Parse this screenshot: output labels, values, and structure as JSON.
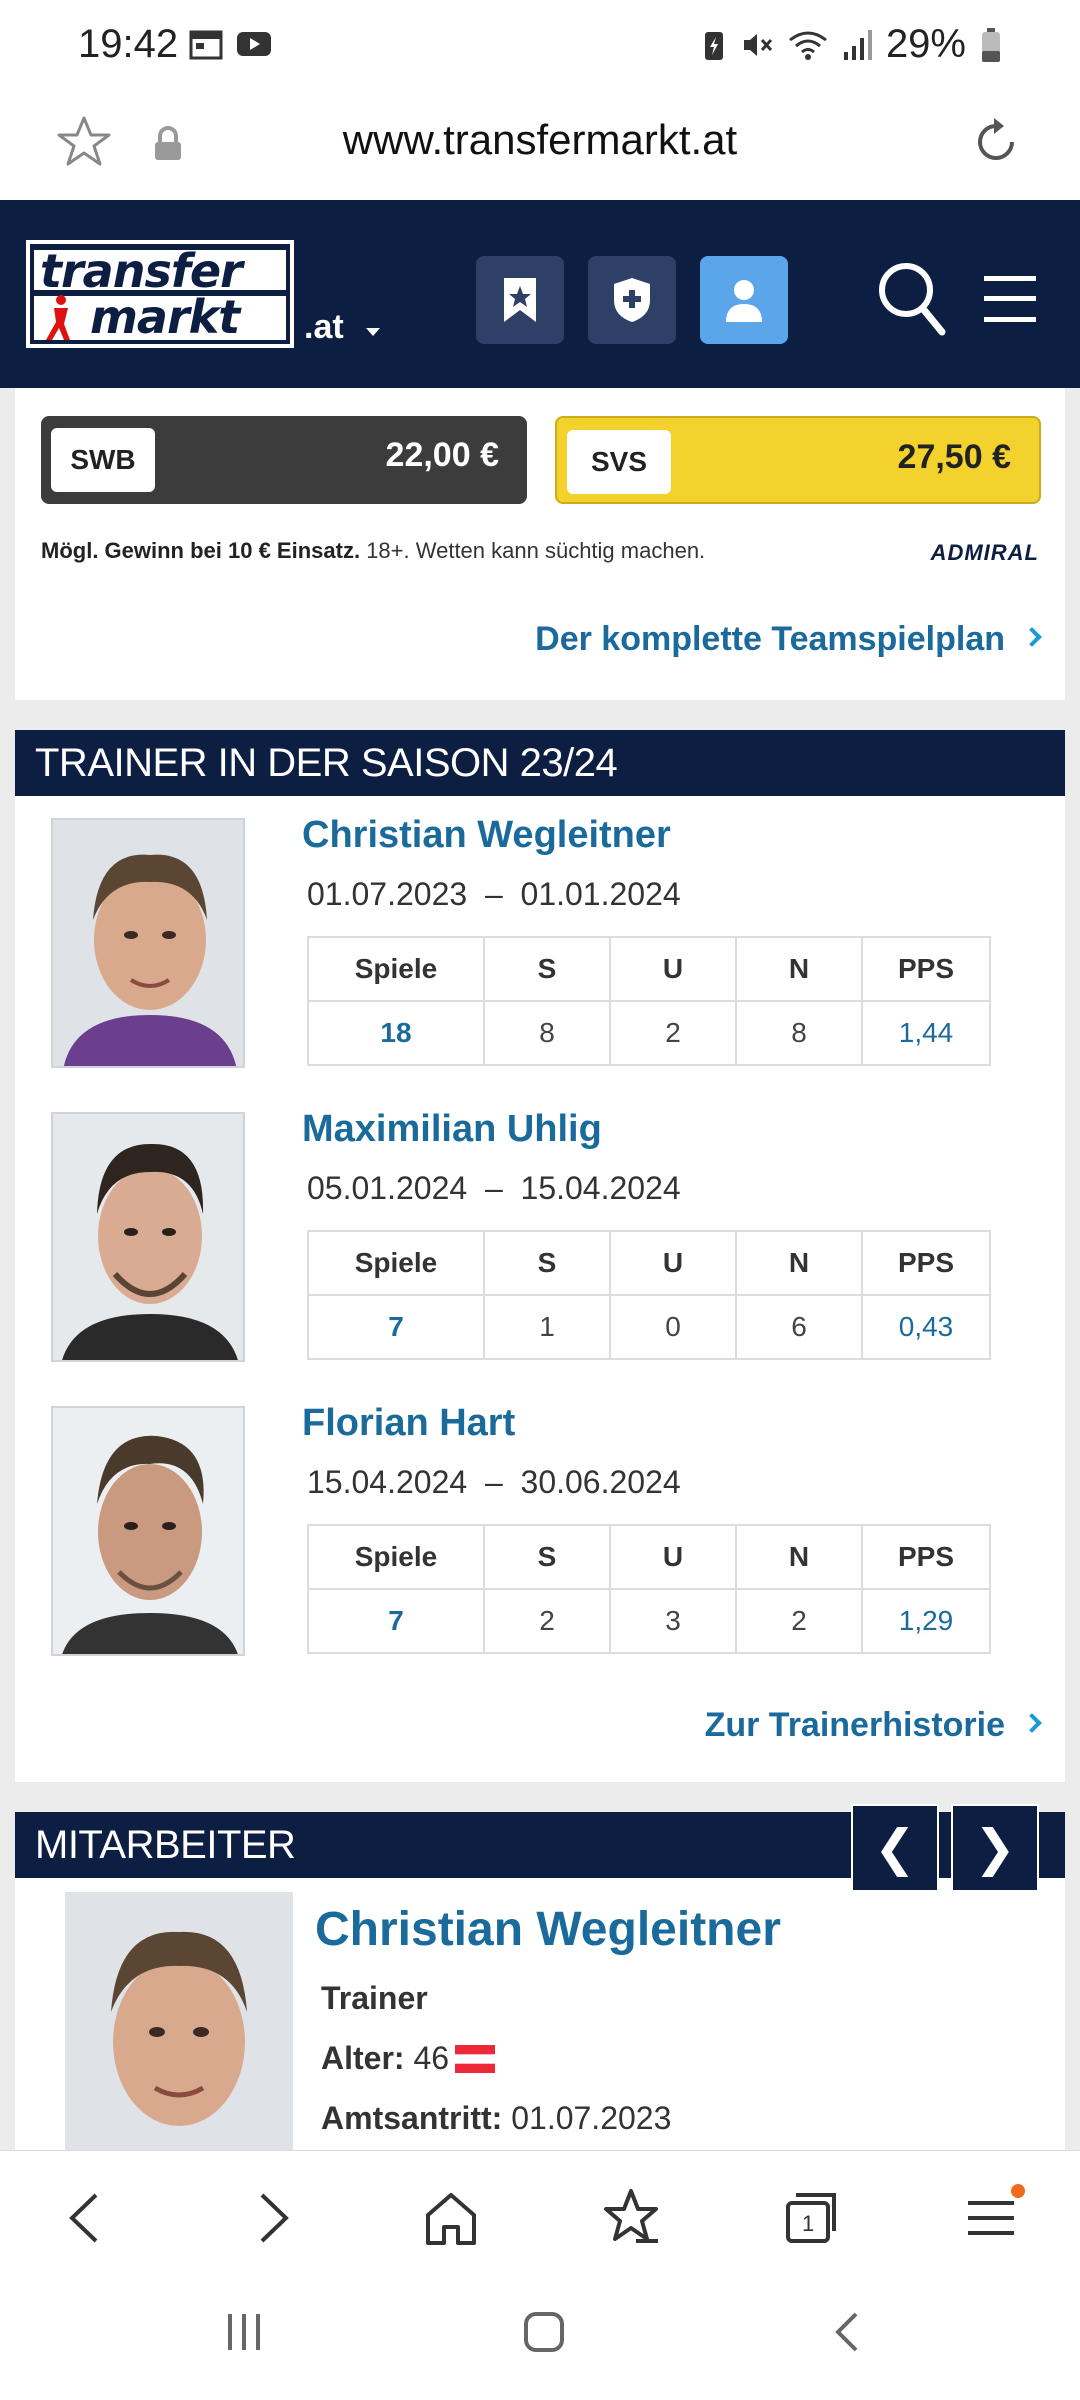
{
  "status_bar": {
    "time": "19:42",
    "battery": "29%",
    "icons": [
      "calendar-icon",
      "youtube-icon",
      "battery-saver-icon",
      "mute-icon",
      "wifi-icon",
      "signal-icon",
      "battery-icon"
    ]
  },
  "browser": {
    "url": "www.transfermarkt.at"
  },
  "site_header": {
    "logo_line1": "transfer",
    "logo_line2": "markt",
    "domain_suffix": ".at"
  },
  "odds": {
    "team1": "SWB",
    "team1_value": "22,00 €",
    "team2": "SVS",
    "team2_value": "27,50 €",
    "disclaimer_bold": "Mögl. Gewinn bei 10 € Einsatz.",
    "disclaimer_rest": " 18+. Wetten kann süchtig machen.",
    "sponsor": "ADMIRAL",
    "link_label": "Der komplette Teamspielplan"
  },
  "trainers": {
    "heading": "TRAINER IN DER SAISON 23/24",
    "columns": [
      "Spiele",
      "S",
      "U",
      "N",
      "PPS"
    ],
    "list": [
      {
        "name": "Christian Wegleitner",
        "from": "01.07.2023",
        "to": "01.01.2024",
        "games": "18",
        "s": "8",
        "u": "2",
        "n": "8",
        "pps": "1,44"
      },
      {
        "name": "Maximilian Uhlig",
        "from": "05.01.2024",
        "to": "15.04.2024",
        "games": "7",
        "s": "1",
        "u": "0",
        "n": "6",
        "pps": "0,43"
      },
      {
        "name": "Florian Hart",
        "from": "15.04.2024",
        "to": "30.06.2024",
        "games": "7",
        "s": "2",
        "u": "3",
        "n": "2",
        "pps": "1,29"
      }
    ],
    "dash": "–",
    "link_label": "Zur Trainerhistorie"
  },
  "staff": {
    "heading": "MITARBEITER",
    "prev": "❮",
    "next": "❯",
    "name": "Christian Wegleitner",
    "role": "Trainer",
    "age_label": "Alter:",
    "age": "46",
    "since_label": "Amtsantritt:",
    "since": "01.07.2023"
  },
  "colors": {
    "navy": "#0c1e42",
    "link": "#1a6a9c",
    "yellow": "#f3d22e",
    "accent_blue": "#5ba6ea"
  }
}
